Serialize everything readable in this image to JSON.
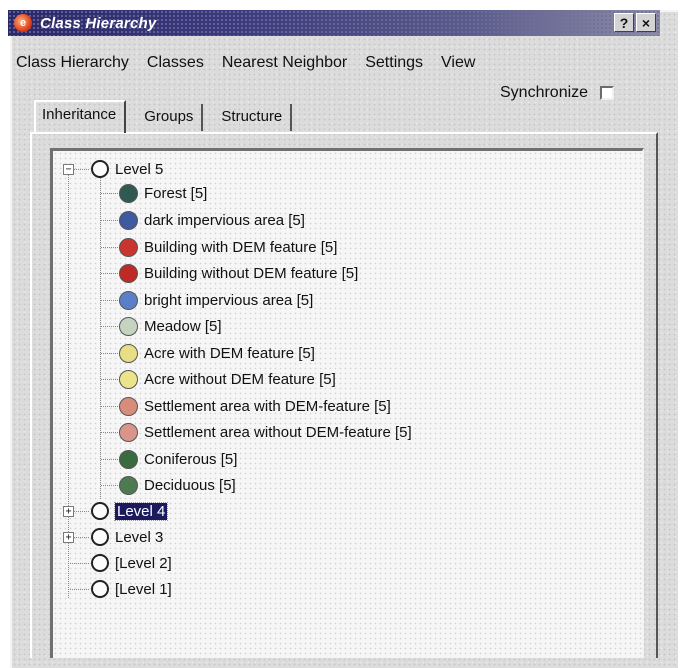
{
  "window": {
    "title": "Class Hierarchy",
    "help_button": "?",
    "close_button": "×"
  },
  "menu": [
    "Class Hierarchy",
    "Classes",
    "Nearest Neighbor",
    "Settings",
    "View"
  ],
  "synchronize_label": "Synchronize",
  "synchronize_checked": false,
  "tabs": [
    "Inheritance",
    "Groups",
    "Structure"
  ],
  "active_tab": "Inheritance",
  "tree": {
    "level5": {
      "label": "Level 5",
      "expanded": true,
      "children": [
        {
          "label": "Forest [5]",
          "color": "#2f5a52"
        },
        {
          "label": "dark impervious area [5]",
          "color": "#3e5aa0"
        },
        {
          "label": "Building with DEM feature [5]",
          "color": "#c8352e"
        },
        {
          "label": "Building without DEM feature [5]",
          "color": "#c02a26"
        },
        {
          "label": "bright impervious area [5]",
          "color": "#5a7fc8"
        },
        {
          "label": "Meadow [5]",
          "color": "#c4d4c0"
        },
        {
          "label": "Acre with DEM feature [5]",
          "color": "#e8de86"
        },
        {
          "label": "Acre without DEM feature [5]",
          "color": "#ece48c"
        },
        {
          "label": "Settlement area with DEM-feature [5]",
          "color": "#d88c7a"
        },
        {
          "label": "Settlement area without DEM-feature [5]",
          "color": "#d8968a"
        },
        {
          "label": "Coniferous [5]",
          "color": "#3a6a40"
        },
        {
          "label": "Deciduous [5]",
          "color": "#4e7a52"
        }
      ]
    },
    "level4": {
      "label": "Level 4",
      "selected": true
    },
    "level3": {
      "label": "Level 3"
    },
    "level2": {
      "label": "[Level 2]"
    },
    "level1": {
      "label": "[Level 1]"
    }
  }
}
